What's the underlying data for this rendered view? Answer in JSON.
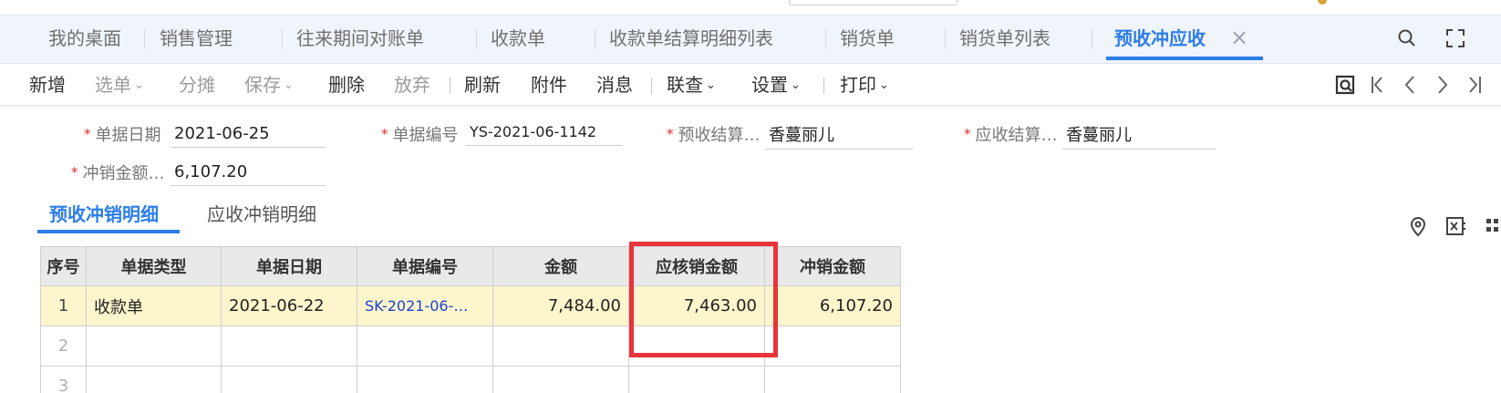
{
  "tabs": [
    {
      "label": "我的桌面"
    },
    {
      "label": "销售管理"
    },
    {
      "label": "往来期间对账单"
    },
    {
      "label": "收款单"
    },
    {
      "label": "收款单结算明细列表"
    },
    {
      "label": "销货单"
    },
    {
      "label": "销货单列表"
    },
    {
      "label": "预收冲应收",
      "active": true
    }
  ],
  "tab_close": "×",
  "toolbar": {
    "add": "新增",
    "select": "选单",
    "allocate": "分摊",
    "save": "保存",
    "delete": "删除",
    "discard": "放弃",
    "refresh": "刷新",
    "attachment": "附件",
    "message": "消息",
    "linked_query": "联查",
    "settings": "设置",
    "print": "打印",
    "caret": "⌄"
  },
  "form": {
    "required_mark": "*",
    "doc_date_label": "单据日期",
    "doc_date_value": "2021-06-25",
    "doc_no_label": "单据编号",
    "doc_no_value": "YS-2021-06-1142",
    "prepay_settle_label": "预收结算…",
    "prepay_settle_value": "香蔓丽儿",
    "receivable_settle_label": "应收结算…",
    "receivable_settle_value": "香蔓丽儿",
    "writeoff_amount_label": "冲销金额…",
    "writeoff_amount_value": "6,107.20"
  },
  "subtabs": {
    "prepay_detail": "预收冲销明细",
    "receivable_detail": "应收冲销明细"
  },
  "grid": {
    "columns": [
      "序号",
      "单据类型",
      "单据日期",
      "单据编号",
      "金额",
      "应核销金额",
      "冲销金额"
    ],
    "rows": [
      {
        "index": "1",
        "doc_type": "收款单",
        "doc_date": "2021-06-22",
        "doc_no": "SK-2021-06-…",
        "amount": "7,484.00",
        "due_writeoff": "7,463.00",
        "writeoff": "6,107.20"
      },
      {
        "index": "2",
        "doc_type": "",
        "doc_date": "",
        "doc_no": "",
        "amount": "",
        "due_writeoff": "",
        "writeoff": ""
      },
      {
        "index": "3",
        "doc_type": "",
        "doc_date": "",
        "doc_no": "",
        "amount": "",
        "due_writeoff": "",
        "writeoff": ""
      }
    ]
  },
  "colors": {
    "accent": "#2b7de8",
    "highlight_row": "#fdf5cc",
    "annotation_box": "#e8333a",
    "required": "#e0292e"
  }
}
